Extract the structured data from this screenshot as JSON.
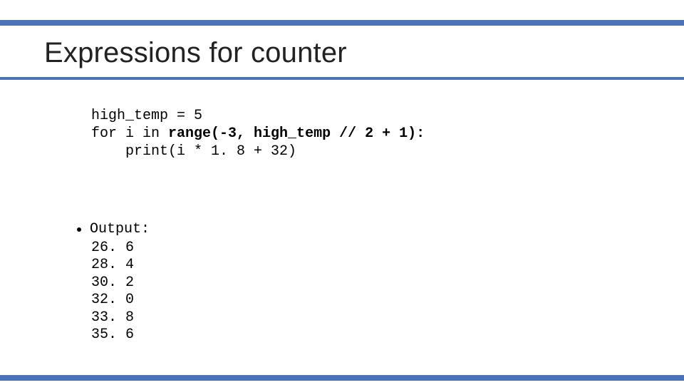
{
  "title": "Expressions for counter",
  "code": {
    "line1": "high_temp = 5",
    "line2a": "for i in ",
    "line2b": "range(-3, high_temp // 2 + 1):",
    "line3": "    print(i * 1. 8 + 32)"
  },
  "output_label": "Output:",
  "output_lines": [
    "26. 6",
    "28. 4",
    "30. 2",
    "32. 0",
    "33. 8",
    "35. 6"
  ]
}
